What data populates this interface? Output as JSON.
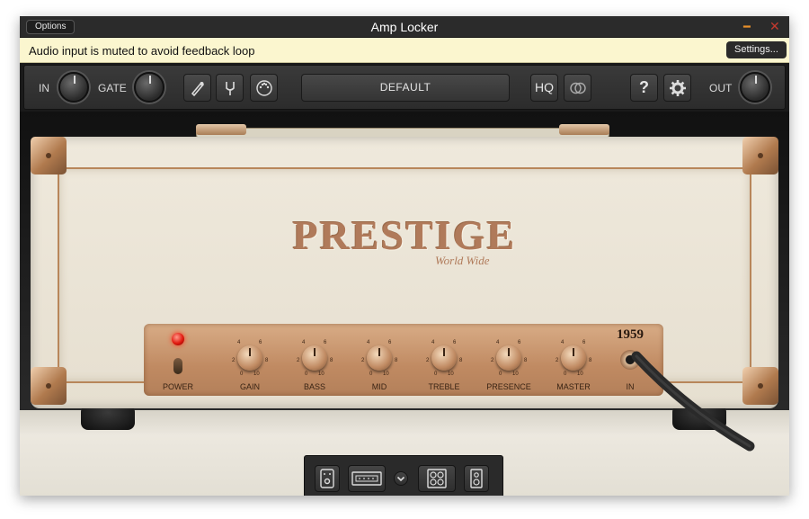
{
  "window": {
    "title": "Amp Locker",
    "options_label": "Options",
    "minimize_icon": "minimize-icon",
    "close_icon": "close-icon"
  },
  "banner": {
    "message": "Audio input is muted to avoid feedback loop",
    "settings_label": "Settings..."
  },
  "toolbar": {
    "in_label": "IN",
    "gate_label": "GATE",
    "out_label": "OUT",
    "preset_name": "DEFAULT",
    "hq_label": "HQ",
    "help_label": "?",
    "icons": [
      "guitar-pick-icon",
      "tuner-fork-icon",
      "midi-icon",
      "stereo-link-icon",
      "gear-icon"
    ]
  },
  "amp": {
    "brand": "PRESTIGE",
    "brand_script": "World Wide",
    "model": "1959",
    "power_label": "POWER",
    "input_label": "IN",
    "knob_scale": {
      "top_left": "4",
      "top_right": "6",
      "left": "2",
      "right": "8",
      "bottom_left": "0",
      "bottom_right": "10"
    },
    "knobs": [
      {
        "label": "GAIN"
      },
      {
        "label": "BASS"
      },
      {
        "label": "MID"
      },
      {
        "label": "TREBLE"
      },
      {
        "label": "PRESENCE"
      },
      {
        "label": "MASTER"
      }
    ]
  },
  "bottom_bar": {
    "icons": [
      "pedal-icon",
      "amp-head-icon",
      "chevron-down-icon",
      "cabinet-icon",
      "speaker-icon"
    ]
  },
  "colors": {
    "banner_bg": "#fbf6cf",
    "copper": "#c08a62",
    "led_red": "#e21a10",
    "tolex": "#efe9dc"
  }
}
